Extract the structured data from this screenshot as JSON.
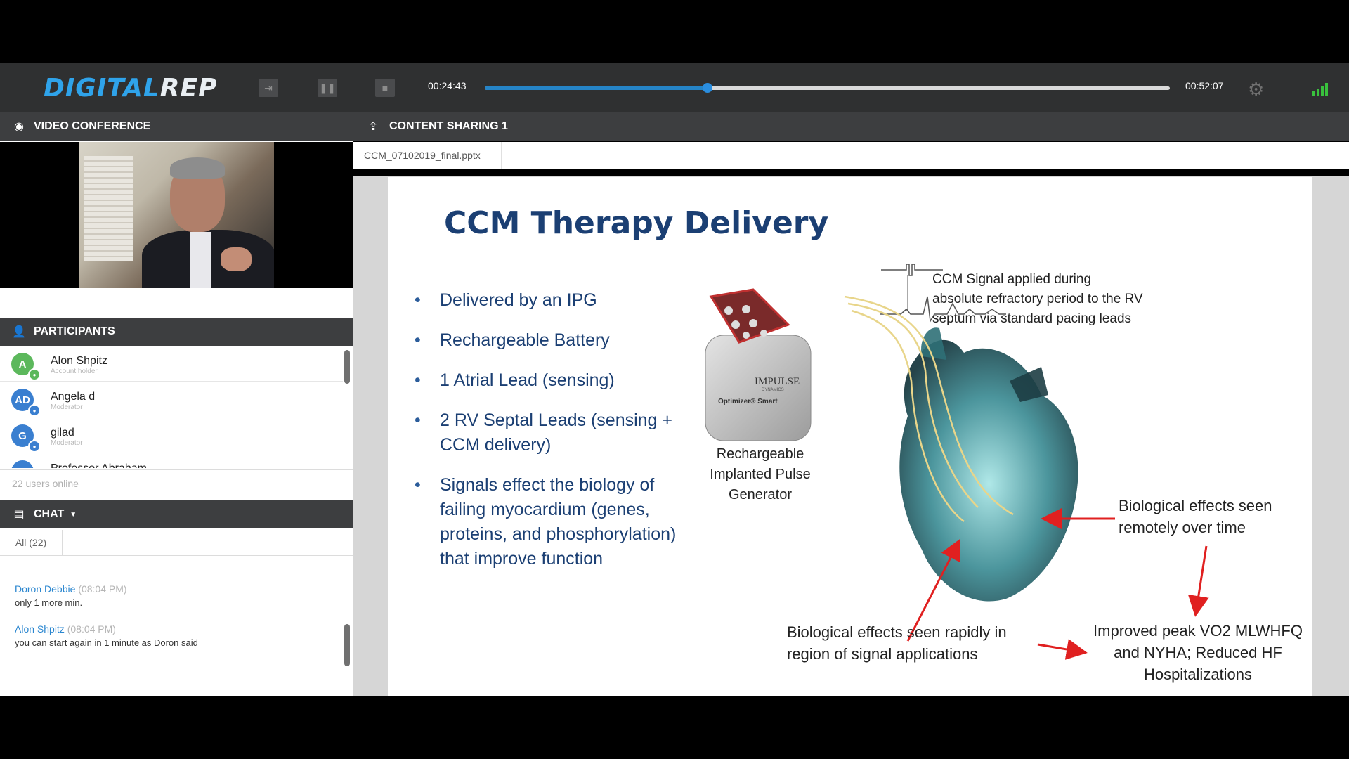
{
  "app": {
    "logo_part1": "DIGITAL",
    "logo_part2": "REP",
    "elapsed": "00:24:43",
    "total": "00:52:07",
    "progress_fraction": 0.325,
    "colors": {
      "accent": "#2584c7",
      "signal": "#39c13d",
      "header": "#3d3e40"
    }
  },
  "controls": [
    {
      "name": "exit-icon"
    },
    {
      "name": "pause-icon"
    },
    {
      "name": "stop-icon"
    }
  ],
  "video": {
    "title": "VIDEO CONFERENCE"
  },
  "participants": {
    "title": "PARTICIPANTS",
    "items": [
      {
        "initials": "A",
        "name": "Alon  Shpitz",
        "role": "Account holder",
        "color": "#5cb85c"
      },
      {
        "initials": "AD",
        "name": "Angela d",
        "role": "Moderator",
        "color": "#3a7fd0"
      },
      {
        "initials": "G",
        "name": "gilad",
        "role": "Moderator",
        "color": "#3a7fd0"
      },
      {
        "initials": "P",
        "name": "Professor  Abraham",
        "role": "",
        "color": "#3a7fd0"
      }
    ],
    "online": "22 users online"
  },
  "chat": {
    "title": "CHAT",
    "tab": "All (22)",
    "messages": [
      {
        "name": "Doron  Debbie",
        "time": "(08:04 PM)",
        "text": "only 1 more min."
      },
      {
        "name": "Alon  Shpitz",
        "time": "(08:04 PM)",
        "text": "you can start again in 1 minute as Doron said"
      }
    ]
  },
  "content": {
    "title": "CONTENT SHARING 1",
    "file": "CCM_07102019_final.pptx"
  },
  "slide": {
    "title": "CCM Therapy Delivery",
    "bullets": [
      "Delivered by an IPG",
      "Rechargeable Battery",
      "1 Atrial Lead (sensing)",
      "2 RV Septal Leads (sensing + CCM delivery)",
      "Signals effect the biology of failing myocardium (genes, proteins, and phosphorylation) that improve function"
    ],
    "device_label": "Rechargeable Implanted Pulse Generator",
    "device_brand": "IMPULSE",
    "device_brand_sub": "DYNAMICS",
    "device_model": "Optimizer® Smart",
    "signal_note": "CCM Signal applied during absolute refractory period to the RV septum via standard pacing leads",
    "effect_remote": "Biological effects seen remotely over time",
    "effect_rapid": "Biological effects seen rapidly in region of signal applications",
    "outcome": "Improved peak VO2 MLWHFQ and NYHA; Reduced HF Hospitalizations"
  }
}
